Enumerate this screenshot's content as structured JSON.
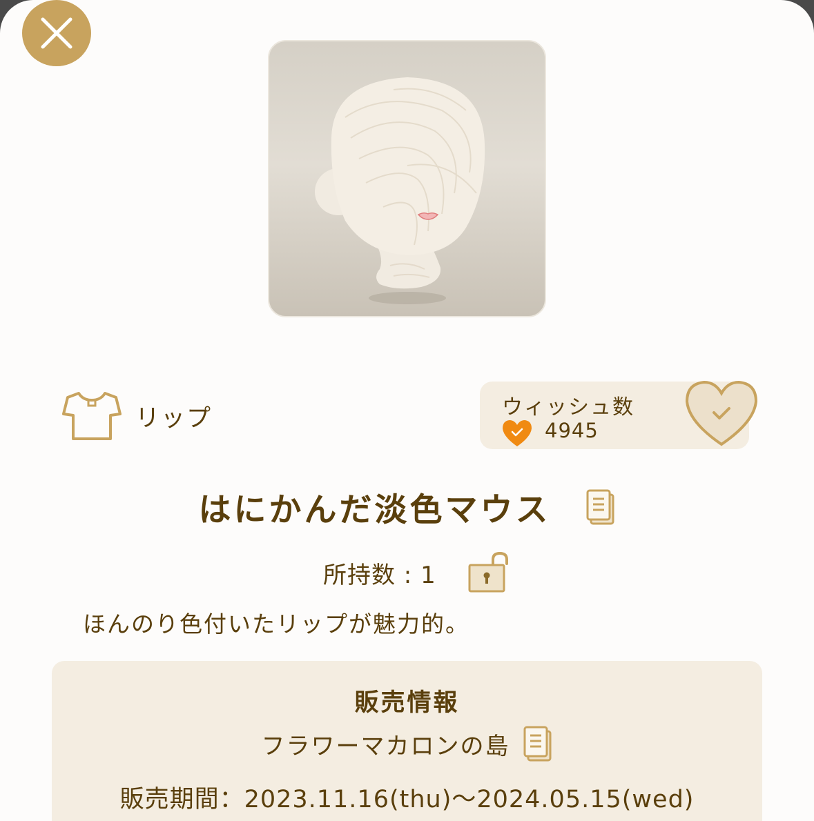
{
  "icons": {
    "close": "close-icon",
    "category": "shirt-icon",
    "wish_count": "heart-check-icon",
    "wish_button": "heart-check-icon",
    "copy": "copy-icon",
    "lock": "unlock-icon"
  },
  "colors": {
    "accent_gold": "#c8a35e",
    "text_brown": "#5a3f0c",
    "panel_beige": "#f4ede1",
    "heart_orange": "#f08a12"
  },
  "item": {
    "category": "リップ",
    "name": "はにかんだ淡色マウス",
    "owned": "所持数 : 1",
    "description": "ほんのり色付いたリップが魅力的。"
  },
  "wish": {
    "title": "ウィッシュ数",
    "count": "4945"
  },
  "sale": {
    "title": "販売情報",
    "shop": "フラワーマカロンの島",
    "period": "販売期間：2023.11.16(thu)〜2024.05.15(wed)"
  }
}
